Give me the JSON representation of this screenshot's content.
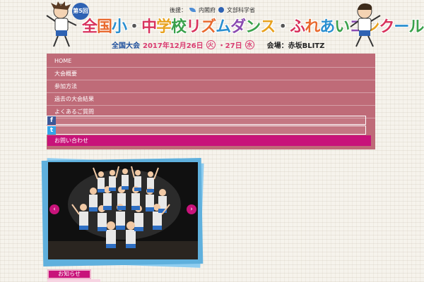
{
  "header": {
    "round_badge": "第5回",
    "sponsor": {
      "label": "後援：",
      "org1": "内閣府",
      "org2": "文部科学省"
    },
    "title_chars": [
      {
        "ch": "全",
        "color": "#d8335d"
      },
      {
        "ch": "国",
        "color": "#e86a2f"
      },
      {
        "ch": "小",
        "color": "#2a8fd0"
      },
      {
        "ch": "・",
        "color": "#555555"
      },
      {
        "ch": "中",
        "color": "#d8335d"
      },
      {
        "ch": "学",
        "color": "#e8a21f"
      },
      {
        "ch": "校",
        "color": "#3aa14b"
      },
      {
        "ch": "リ",
        "color": "#d8335d"
      },
      {
        "ch": "ズ",
        "color": "#e86a2f"
      },
      {
        "ch": "ム",
        "color": "#2a8fd0"
      },
      {
        "ch": "ダ",
        "color": "#8a4ab0"
      },
      {
        "ch": "ン",
        "color": "#3aa14b"
      },
      {
        "ch": "ス",
        "color": "#e8a21f"
      },
      {
        "ch": "・",
        "color": "#555555"
      },
      {
        "ch": "ふ",
        "color": "#d8335d"
      },
      {
        "ch": "れ",
        "color": "#e86a2f"
      },
      {
        "ch": "あ",
        "color": "#2a8fd0"
      },
      {
        "ch": "い",
        "color": "#3aa14b"
      },
      {
        "ch": "コ",
        "color": "#8a4ab0"
      },
      {
        "ch": "ン",
        "color": "#e8a21f"
      },
      {
        "ch": "ク",
        "color": "#d8335d"
      },
      {
        "ch": "ー",
        "color": "#2a8fd0"
      },
      {
        "ch": "ル",
        "color": "#3aa14b"
      }
    ],
    "event_label": "全国大会",
    "date_main": "2017年12月26日",
    "day1": "火",
    "separator": "・27日",
    "day2": "水",
    "venue": "会場：赤坂BLITZ"
  },
  "nav": {
    "items": [
      {
        "label": "HOME"
      },
      {
        "label": "大会概要"
      },
      {
        "label": "参加方法"
      },
      {
        "label": "過去の大会結果"
      },
      {
        "label": "よくあるご質問"
      }
    ],
    "facebook_icon": "f",
    "twitter_icon": "t",
    "contact_label": "お問い合わせ"
  },
  "slider": {
    "prev_glyph": "‹",
    "next_glyph": "›"
  },
  "bottom": {
    "section_label": "お知らせ"
  },
  "colors": {
    "nav_bg": "#bf6b78",
    "accent": "#c8137a",
    "slider_frame": "#5fb0dd"
  }
}
